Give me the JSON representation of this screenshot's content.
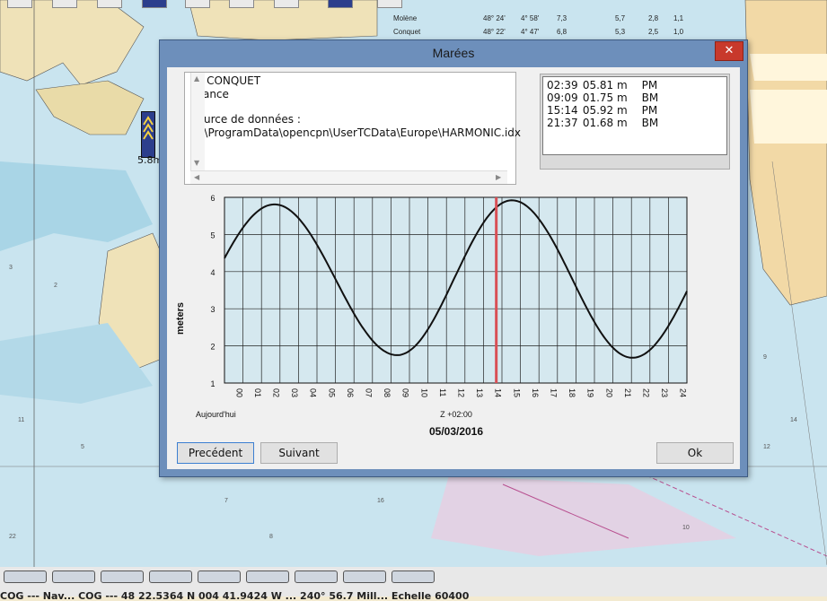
{
  "dialog": {
    "title": "Marées",
    "close_label": "✕",
    "station": {
      "name": "LE CONQUET",
      "country": "France",
      "source_label": "Source de données :",
      "source_path": "C:\\ProgramData\\opencpn\\UserTCData\\Europe\\HARMONIC.idx"
    },
    "tides": [
      {
        "time": "02:39",
        "height": "05.81 m",
        "type": "PM"
      },
      {
        "time": "09:09",
        "height": "01.75 m",
        "type": "BM"
      },
      {
        "time": "15:14",
        "height": "05.92 m",
        "type": "PM"
      },
      {
        "time": "21:37",
        "height": "01.68 m",
        "type": "BM"
      }
    ],
    "buttons": {
      "prev": "Precédent",
      "next": "Suivant",
      "ok": "Ok"
    }
  },
  "chart_data": {
    "type": "line",
    "ylabel": "meters",
    "ylim": [
      1,
      6
    ],
    "y_ticks": [
      "1",
      "2",
      "3",
      "4",
      "5",
      "6"
    ],
    "x_ticks": [
      "00",
      "01",
      "02",
      "03",
      "04",
      "05",
      "06",
      "07",
      "08",
      "09",
      "10",
      "11",
      "12",
      "13",
      "14",
      "15",
      "16",
      "17",
      "18",
      "19",
      "20",
      "21",
      "22",
      "23",
      "24"
    ],
    "xlim": [
      0,
      24.5
    ],
    "extremes": [
      {
        "x": 2.65,
        "y": 5.81
      },
      {
        "x": 9.15,
        "y": 1.75
      },
      {
        "x": 15.23,
        "y": 5.92
      },
      {
        "x": 21.62,
        "y": 1.68
      }
    ],
    "start_value": 4.3,
    "end_value": 4.35,
    "current_time_hour": 14.4,
    "current_time_color": "#d94f55",
    "line_color": "#111111",
    "background_color": "#d5e8ef",
    "grid": true,
    "day_label": "Aujourd'hui",
    "timezone_label": "Z +02:00",
    "date_label": "05/03/2016"
  },
  "map": {
    "tide_flag_label": "5.8m",
    "table_rows": [
      {
        "name": "Molène",
        "lat": "48° 24'",
        "lon": "4° 58'",
        "v1": "7,3",
        "v2": "5,7",
        "v3": "2,8",
        "v4": "1,1"
      },
      {
        "name": "Conquet",
        "lat": "48° 22'",
        "lon": "4° 47'",
        "v1": "6,8",
        "v2": "5,3",
        "v3": "2,5",
        "v4": "1,0"
      }
    ]
  },
  "statusbar": {
    "text": "COG --- Nav... COG --- 48 22.5364 N 004 41.9424 W ... 240° 56.7 Mill... Echelle 60400"
  }
}
